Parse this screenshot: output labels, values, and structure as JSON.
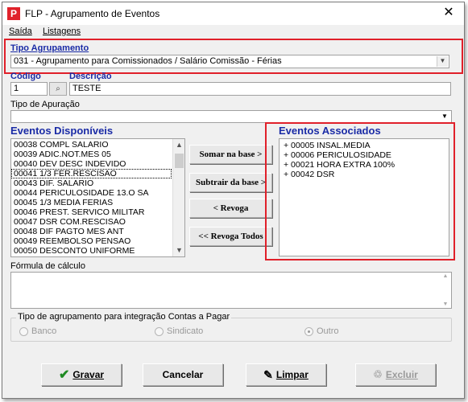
{
  "window": {
    "title": "FLP - Agrupamento de Eventos",
    "close_glyph": "✕",
    "app_icon_letter": "P"
  },
  "menu": {
    "items": [
      "Saída",
      "Listagens"
    ]
  },
  "tipo_agrupamento": {
    "label": "Tipo Agrupamento",
    "value": "031 - Agrupamento para Comissionados / Salário Comissão - Férias"
  },
  "codigo": {
    "label": "Código",
    "value": "1",
    "lookup_icon": "binoculars-icon"
  },
  "descricao": {
    "label": "Descrição",
    "value": "TESTE"
  },
  "tipo_apuracao": {
    "label": "Tipo de Apuração",
    "value": ""
  },
  "eventos_disponiveis": {
    "label": "Eventos Disponíveis",
    "items": [
      "00038 COMPL SALARIO",
      "00039 ADIC.NOT.MES 05",
      "00040 DEV DESC INDEVIDO",
      "00041 1/3 FER.RESCISAO",
      "00043 DIF. SALARIO",
      "00044 PERICULOSIDADE 13.O SA",
      "00045 1/3 MEDIA FERIAS",
      "00046 PREST. SERVICO MILITAR",
      "00047 DSR COM.RESCISAO",
      "00048 DIF PAGTO MES ANT",
      "00049 REEMBOLSO PENSAO",
      "00050 DESCONTO UNIFORME"
    ],
    "focused_index": 3
  },
  "buttons_mid": {
    "somar": "Somar  na base >",
    "subtrair": "Subtrair da base >",
    "revoga": "< Revoga",
    "revoga_todos": "<< Revoga Todos"
  },
  "eventos_associados": {
    "label": "Eventos Associados",
    "items": [
      "+ 00005 INSAL.MEDIA",
      "+ 00006 PERICULOSIDADE",
      "+ 00021 HORA EXTRA 100%",
      "+ 00042 DSR"
    ]
  },
  "formula": {
    "label": "Fórmula de cálculo",
    "value": ""
  },
  "integracao": {
    "label": "Tipo de agrupamento para integração Contas a Pagar",
    "options": [
      "Banco",
      "Sindicato",
      "Outro"
    ],
    "selected": "Outro"
  },
  "footer": {
    "gravar": "Gravar",
    "cancelar": "Cancelar",
    "limpar": "Limpar",
    "excluir": "Excluir"
  },
  "colors": {
    "highlight_box": "#e0202a",
    "label_blue": "#1a2ba6",
    "gravar_check": "#1f8a22"
  }
}
